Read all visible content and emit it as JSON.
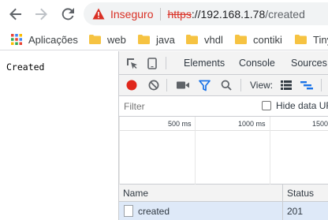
{
  "browser": {
    "address_bar": {
      "security_label": "Inseguro",
      "scheme": "https",
      "host": "://192.168.1.78",
      "path": "/created"
    },
    "bookmarks": [
      {
        "label": "Aplicações",
        "icon": "apps-grid-icon"
      },
      {
        "label": "web",
        "icon": "folder-icon"
      },
      {
        "label": "java",
        "icon": "folder-icon"
      },
      {
        "label": "vhdl",
        "icon": "folder-icon"
      },
      {
        "label": "contiki",
        "icon": "folder-icon"
      },
      {
        "label": "Tiny",
        "icon": "folder-icon"
      }
    ]
  },
  "page": {
    "body_text": "Created"
  },
  "devtools": {
    "tabs": [
      "Elements",
      "Console",
      "Sources"
    ],
    "controls": {
      "view_label": "View:"
    },
    "filter": {
      "placeholder": "Filter",
      "hide_data_label": "Hide data UR"
    },
    "timeline": {
      "ticks": [
        "500 ms",
        "1000 ms",
        "1500"
      ]
    },
    "table": {
      "columns": [
        "Name",
        "Status"
      ],
      "rows": [
        {
          "name": "created",
          "status": "201"
        }
      ]
    }
  },
  "colors": {
    "insecure_red": "#d93025",
    "record_red": "#e0271b",
    "filter_blue": "#1a73e8",
    "folder_yellow": "#f6c342",
    "selected_row": "#dee9f8"
  }
}
